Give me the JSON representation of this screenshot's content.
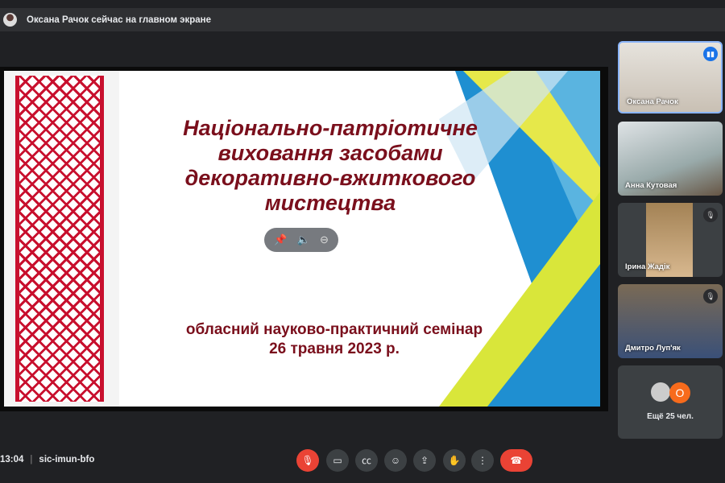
{
  "banner": {
    "text": "Оксана Рачок сейчас на главном экране"
  },
  "slide": {
    "title_lines": [
      "Національно-патріотичне",
      "виховання засобами",
      "декоративно-вжиткового",
      "мистецтва"
    ],
    "subtitle_lines": [
      "обласний науково-практичний семінар",
      "26 травня 2023 р."
    ]
  },
  "participants": [
    {
      "name": "Оксана Рачок"
    },
    {
      "name": "Анна Кутовая"
    },
    {
      "name": "Ірина Жадік"
    },
    {
      "name": "Дмитро Луп'як"
    }
  ],
  "more": {
    "initial": "О",
    "label": "Ещё 25 чел."
  },
  "footer": {
    "time": "13:04",
    "meeting_code": "sic-imun-bfo"
  },
  "colors": {
    "accent": "#1a73e8",
    "danger": "#ea4335",
    "title": "#7a0f1c"
  }
}
